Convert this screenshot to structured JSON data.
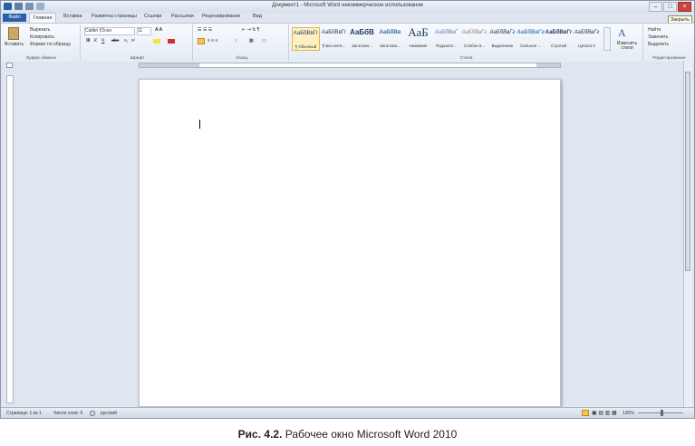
{
  "window": {
    "title": "Документ1 - Microsoft Word некоммерческое использование",
    "controls": [
      "–",
      "□",
      "×"
    ],
    "tooltip": "Закрыть"
  },
  "tabs": {
    "file": "Файл",
    "items": [
      "Главная",
      "Вставка",
      "Разметка страницы",
      "Ссылки",
      "Рассылки",
      "Рецензирование",
      "Вид"
    ]
  },
  "ribbon": {
    "clipboard": {
      "name": "Буфер обмена",
      "paste": "Вставить",
      "cut": "Вырезать",
      "copy": "Копировать",
      "format_painter": "Формат по образцу"
    },
    "font": {
      "name": "Шрифт",
      "font_name": "Calibri (Осно",
      "font_size": "11"
    },
    "paragraph": {
      "name": "Абзац"
    },
    "styles": {
      "name": "Стили",
      "items": [
        {
          "sample": "АаБбВвГг",
          "label": "¶ Обычный"
        },
        {
          "sample": "АаБбВвГг",
          "label": "¶ Без инте..."
        },
        {
          "sample": "АаБбВ",
          "label": "Заголово..."
        },
        {
          "sample": "АаБбВв",
          "label": "Заголово..."
        },
        {
          "sample": "АаБ",
          "label": "Название"
        },
        {
          "sample": "АаБбВеГ",
          "label": "Подзагол..."
        },
        {
          "sample": "АаБбВвГг",
          "label": "Слабое в..."
        },
        {
          "sample": "АаБбВвГг",
          "label": "Выделение"
        },
        {
          "sample": "АаБбВвГг",
          "label": "Сильное ..."
        },
        {
          "sample": "АаБбВвГг",
          "label": "Строгий"
        },
        {
          "sample": "АаБбВвГг",
          "label": "Цитата 2"
        }
      ],
      "change_styles": "Изменить стили"
    },
    "editing": {
      "name": "Редактирование",
      "find": "Найти",
      "replace": "Заменить",
      "select": "Выделить"
    }
  },
  "statusbar": {
    "page": "Страница: 1 из 1",
    "words": "Число слов: 0",
    "language": "русский",
    "zoom": "130%"
  },
  "caption": {
    "bold": "Рис. 4.2.",
    "text": " Рабочее окно Microsoft Word 2010"
  }
}
